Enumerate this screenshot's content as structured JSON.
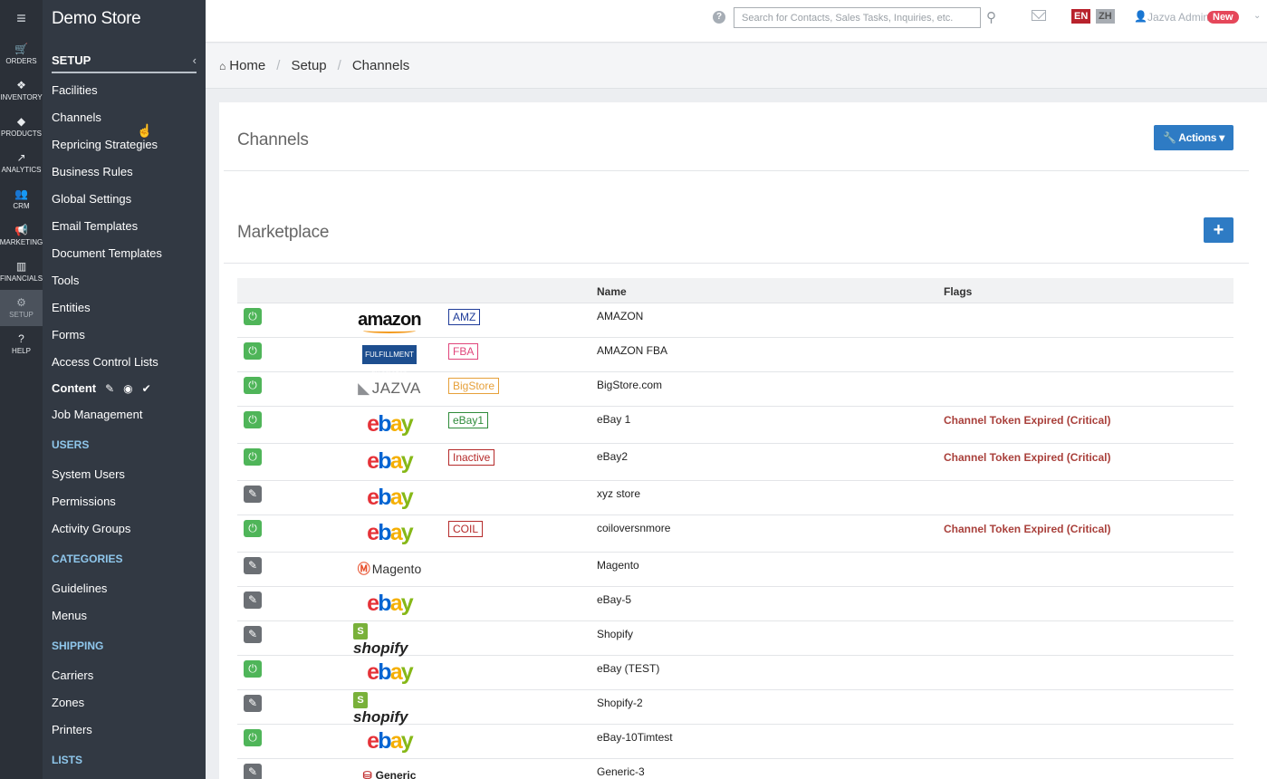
{
  "rail": [
    {
      "key": "orders",
      "label": "ORDERS",
      "icon": "cart-icon",
      "glyph": "🛒"
    },
    {
      "key": "inventory",
      "label": "INVENTORY",
      "icon": "cubes-icon",
      "glyph": "❖"
    },
    {
      "key": "products",
      "label": "PRODUCTS",
      "icon": "tags-icon",
      "glyph": "◆"
    },
    {
      "key": "analytics",
      "label": "ANALYTICS",
      "icon": "line-chart-icon",
      "glyph": "↗"
    },
    {
      "key": "crm",
      "label": "CRM",
      "icon": "users-icon",
      "glyph": "👥"
    },
    {
      "key": "marketing",
      "label": "MARKETING",
      "icon": "bullhorn-icon",
      "glyph": "📢"
    },
    {
      "key": "financials",
      "label": "FINANCIALS",
      "icon": "bar-chart-icon",
      "glyph": "▥"
    },
    {
      "key": "setup",
      "label": "SETUP",
      "icon": "gear-icon",
      "glyph": "⚙",
      "active": true
    },
    {
      "key": "help",
      "label": "HELP",
      "icon": "question-icon",
      "glyph": "?"
    }
  ],
  "sidebar": {
    "store_title": "Demo Store",
    "setup_title": "SETUP",
    "setup_items": [
      "Facilities",
      "Channels",
      "Repricing Strategies",
      "Business Rules",
      "Global Settings",
      "Email Templates",
      "Document Templates",
      "Tools",
      "Entities",
      "Forms",
      "Access Control Lists"
    ],
    "content_label": "Content",
    "after_content": [
      "Job Management"
    ],
    "sections": [
      {
        "title": "USERS",
        "items": [
          "System Users",
          "Permissions",
          "Activity Groups"
        ]
      },
      {
        "title": "CATEGORIES",
        "items": [
          "Guidelines",
          "Menus"
        ]
      },
      {
        "title": "SHIPPING",
        "items": [
          "Carriers",
          "Zones",
          "Printers"
        ]
      },
      {
        "title": "LISTS",
        "items": []
      }
    ]
  },
  "topbar": {
    "search_placeholder": "Search for Contacts, Sales Tasks, Inquiries, etc.",
    "lang_en": "EN",
    "lang_zh": "ZH",
    "user_name": "Jazva Admin",
    "new_badge": "New"
  },
  "breadcrumb": {
    "home": "Home",
    "setup": "Setup",
    "current": "Channels"
  },
  "page": {
    "title": "Channels",
    "actions_label": "Actions",
    "marketplace_title": "Marketplace",
    "add_label": "+"
  },
  "table": {
    "headers": {
      "name": "Name",
      "flags": "Flags"
    },
    "rows": [
      {
        "status": "on",
        "logo": "amazon",
        "badge": "AMZ",
        "badge_color": "#1f3c99",
        "name": "AMAZON",
        "flag": "",
        "h": 38
      },
      {
        "status": "on",
        "logo": "fba",
        "badge": "FBA",
        "badge_color": "#e0457b",
        "name": "AMAZON FBA",
        "flag": "",
        "h": 38
      },
      {
        "status": "on",
        "logo": "jazva",
        "badge": "BigStore",
        "badge_color": "#e6a03a",
        "name": "BigStore.com",
        "flag": "",
        "h": 38
      },
      {
        "status": "on",
        "logo": "ebay",
        "badge": "eBay1",
        "badge_color": "#2e8b3a",
        "name": "eBay 1",
        "flag": "Channel Token Expired (Critical)",
        "h": 41
      },
      {
        "status": "on",
        "logo": "ebay",
        "badge": "Inactive",
        "badge_color": "#b52a2a",
        "name": "eBay2",
        "flag": "Channel Token Expired (Critical)",
        "h": 41
      },
      {
        "status": "off",
        "logo": "ebay",
        "badge": "",
        "badge_color": "",
        "name": "xyz store",
        "flag": "",
        "h": 38
      },
      {
        "status": "on",
        "logo": "ebay",
        "badge": "COIL",
        "badge_color": "#b52a2a",
        "name": "coiloversnmore",
        "flag": "Channel Token Expired (Critical)",
        "h": 41
      },
      {
        "status": "off",
        "logo": "magento",
        "badge": "",
        "badge_color": "",
        "name": "Magento",
        "flag": "",
        "h": 38
      },
      {
        "status": "off",
        "logo": "ebay",
        "badge": "",
        "badge_color": "",
        "name": "eBay-5",
        "flag": "",
        "h": 38
      },
      {
        "status": "off",
        "logo": "shopify",
        "badge": "",
        "badge_color": "",
        "name": "Shopify",
        "flag": "",
        "h": 38
      },
      {
        "status": "on",
        "logo": "ebay",
        "badge": "",
        "badge_color": "",
        "name": "eBay (TEST)",
        "flag": "",
        "h": 38
      },
      {
        "status": "off",
        "logo": "shopify",
        "badge": "",
        "badge_color": "",
        "name": "Shopify-2",
        "flag": "",
        "h": 38
      },
      {
        "status": "on",
        "logo": "ebay",
        "badge": "",
        "badge_color": "",
        "name": "eBay-10Timtest",
        "flag": "",
        "h": 38
      },
      {
        "status": "off",
        "logo": "generic",
        "badge": "",
        "badge_color": "",
        "name": "Generic-3",
        "flag": "",
        "h": 38
      }
    ]
  },
  "logo_text": {
    "amazon": "amazon",
    "fba": "FULFILLMENT by amazon",
    "jazva": "JAZVA",
    "magento": "Magento",
    "shopify": "shopify",
    "generic": "Generic"
  }
}
